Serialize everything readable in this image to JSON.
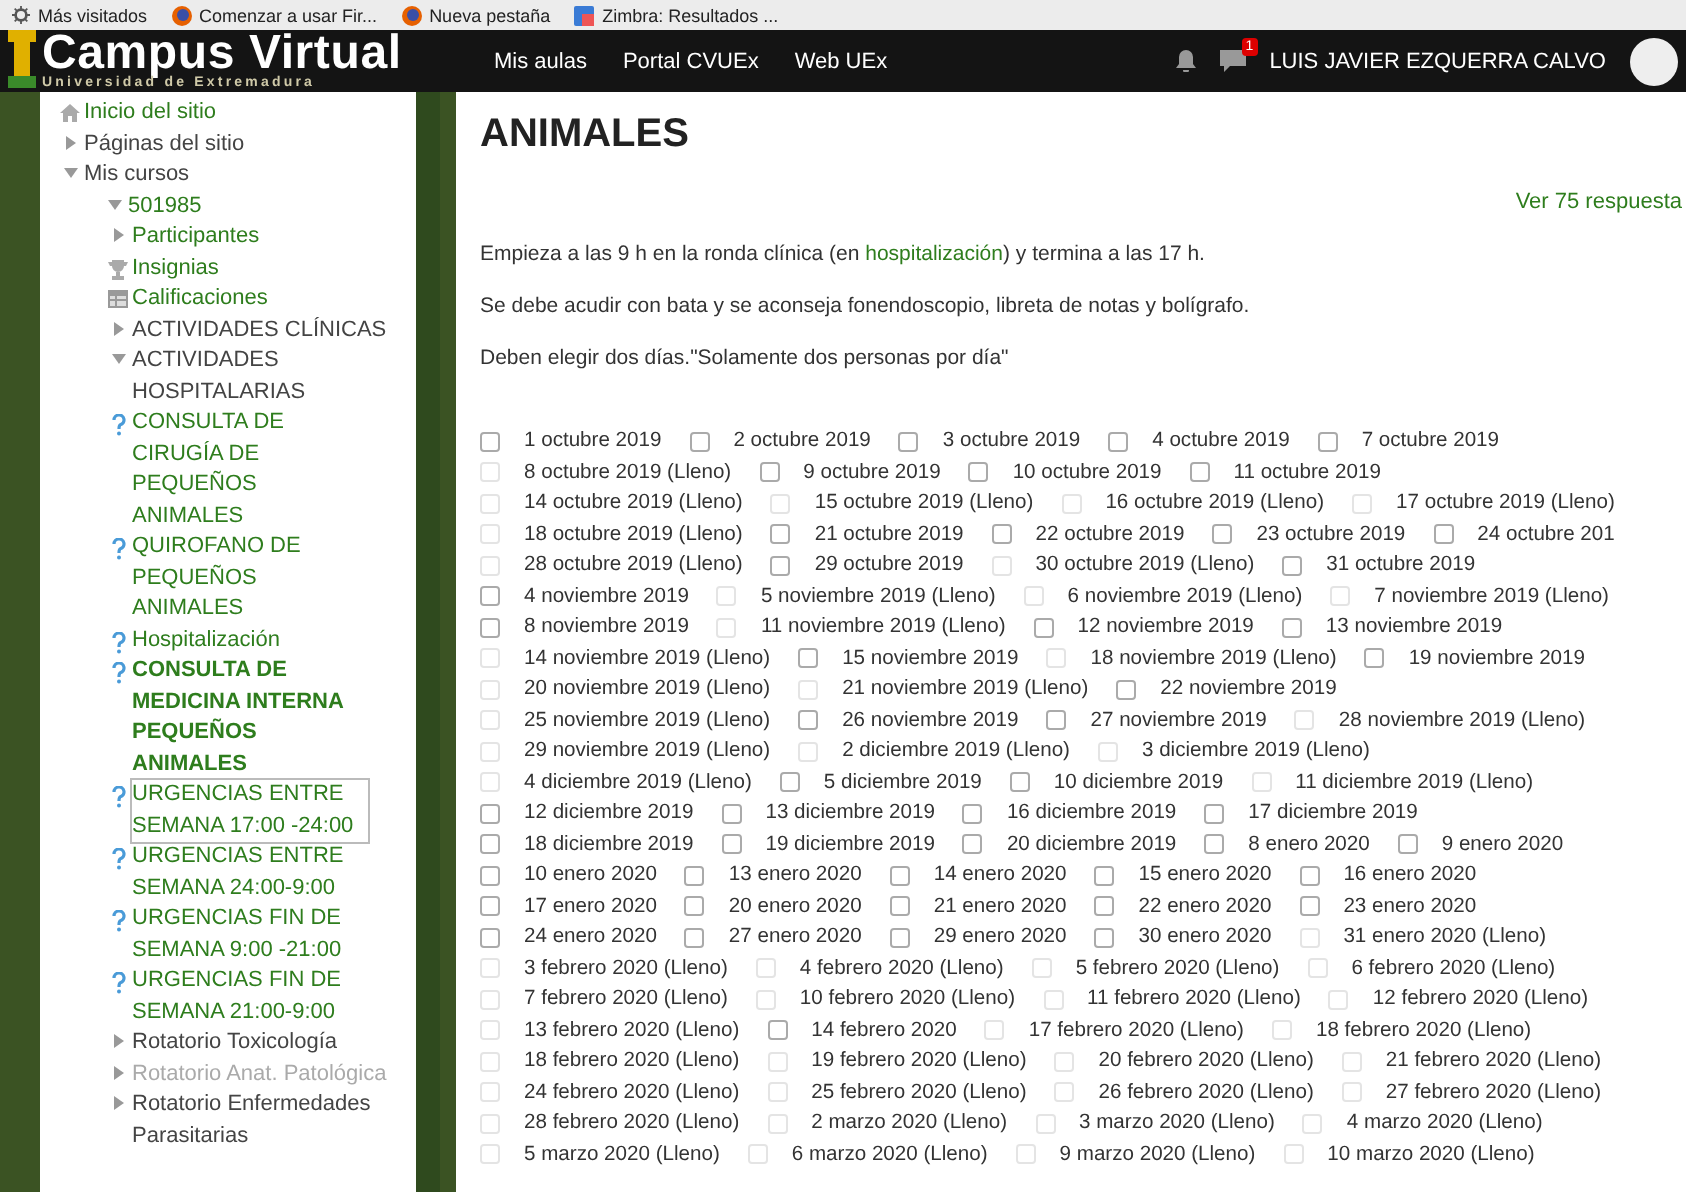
{
  "bookmarks": [
    {
      "kind": "gear",
      "label": "Más visitados"
    },
    {
      "kind": "browser",
      "label": "Comenzar a usar Fir..."
    },
    {
      "kind": "browser",
      "label": "Nueva pestaña"
    },
    {
      "kind": "mail",
      "label": "Zimbra: Resultados ..."
    }
  ],
  "header": {
    "logo_title": "Campus Virtual",
    "logo_subtitle": "Universidad de Extremadura",
    "nav": [
      "Mis aulas",
      "Portal CVUEx",
      "Web UEx"
    ],
    "message_count": "1",
    "user_name": "LUIS JAVIER EZQUERRA CALVO"
  },
  "sidebar": {
    "items": [
      {
        "kind": "home",
        "label": "Inicio del sitio"
      },
      {
        "kind": "branch",
        "label": "Páginas del sitio",
        "expanded": false
      },
      {
        "kind": "branch",
        "label": "Mis cursos",
        "expanded": true,
        "children": [
          {
            "kind": "branch",
            "label": "501985",
            "expanded": true,
            "link": true,
            "children": [
              {
                "kind": "branch",
                "label": "Participantes",
                "expanded": false,
                "link": true
              },
              {
                "kind": "badges",
                "label": "Insignias"
              },
              {
                "kind": "grades",
                "label": "Calificaciones"
              },
              {
                "kind": "branch",
                "label": "ACTIVIDADES CLÍNICAS",
                "expanded": false
              },
              {
                "kind": "branch",
                "label": "ACTIVIDADES HOSPITALARIAS",
                "expanded": true,
                "children": [
                  {
                    "kind": "quiz",
                    "label": "CONSULTA DE CIRUGÍA DE PEQUEÑOS ANIMALES",
                    "current": false,
                    "focused": false
                  },
                  {
                    "kind": "quiz",
                    "label": "QUIROFANO DE PEQUEÑOS ANIMALES",
                    "current": false,
                    "focused": false
                  },
                  {
                    "kind": "quiz",
                    "label": "Hospitalización",
                    "current": false,
                    "focused": false
                  },
                  {
                    "kind": "quiz",
                    "label": "CONSULTA DE MEDICINA INTERNA PEQUEÑOS ANIMALES",
                    "current": true,
                    "focused": false
                  },
                  {
                    "kind": "quiz",
                    "label": "URGENCIAS ENTRE SEMANA 17:00 -24:00",
                    "current": false,
                    "focused": true
                  },
                  {
                    "kind": "quiz",
                    "label": "URGENCIAS ENTRE SEMANA 24:00-9:00",
                    "current": false,
                    "focused": false
                  },
                  {
                    "kind": "quiz",
                    "label": "URGENCIAS FIN DE SEMANA 9:00 -21:00",
                    "current": false,
                    "focused": false
                  },
                  {
                    "kind": "quiz",
                    "label": "URGENCIAS FIN DE SEMANA 21:00-9:00",
                    "current": false,
                    "focused": false
                  }
                ]
              },
              {
                "kind": "branch",
                "label": "Rotatorio Toxicología",
                "expanded": false,
                "disabled": false
              },
              {
                "kind": "branch",
                "label": "Rotatorio Anat. Patológica",
                "expanded": false,
                "disabled": true
              },
              {
                "kind": "branch",
                "label": "Rotatorio Enfermedades Parasitarias",
                "expanded": false,
                "disabled": false
              }
            ]
          }
        ]
      }
    ]
  },
  "main": {
    "title": "ANIMALES",
    "responses_link": "Ver 75 respuesta",
    "intro": {
      "before": "Empieza a las 9 h en la ronda clínica (en ",
      "link": "hospitalización",
      "after": ") y termina a las 17 h."
    },
    "paragraphs": [
      "Se debe acudir con bata y se aconseja fonendoscopio, libreta de notas y bolígrafo.",
      "Deben elegir dos días.\"Solamente dos personas por día\""
    ],
    "option_rows": [
      [
        {
          "label": "1 octubre 2019",
          "disabled": false
        },
        {
          "label": "2 octubre 2019",
          "disabled": false
        },
        {
          "label": "3 octubre 2019",
          "disabled": false
        },
        {
          "label": "4 octubre 2019",
          "disabled": false
        },
        {
          "label": "7 octubre 2019",
          "disabled": false
        }
      ],
      [
        {
          "label": "8 octubre 2019 (Lleno)",
          "disabled": true
        },
        {
          "label": "9 octubre 2019",
          "disabled": false
        },
        {
          "label": "10 octubre 2019",
          "disabled": false
        },
        {
          "label": "11 octubre 2019",
          "disabled": false
        }
      ],
      [
        {
          "label": "14 octubre 2019 (Lleno)",
          "disabled": true
        },
        {
          "label": "15 octubre 2019 (Lleno)",
          "disabled": true
        },
        {
          "label": "16 octubre 2019 (Lleno)",
          "disabled": true
        },
        {
          "label": "17 octubre 2019 (Lleno)",
          "disabled": true
        }
      ],
      [
        {
          "label": "18 octubre 2019 (Lleno)",
          "disabled": true
        },
        {
          "label": "21 octubre 2019",
          "disabled": false
        },
        {
          "label": "22 octubre 2019",
          "disabled": false
        },
        {
          "label": "23 octubre 2019",
          "disabled": false
        },
        {
          "label": "24 octubre 201",
          "disabled": false
        }
      ],
      [
        {
          "label": "28 octubre 2019 (Lleno)",
          "disabled": true
        },
        {
          "label": "29 octubre 2019",
          "disabled": false
        },
        {
          "label": "30 octubre 2019 (Lleno)",
          "disabled": true
        },
        {
          "label": "31 octubre 2019",
          "disabled": false
        }
      ],
      [
        {
          "label": "4 noviembre 2019",
          "disabled": false
        },
        {
          "label": "5 noviembre 2019 (Lleno)",
          "disabled": true
        },
        {
          "label": "6 noviembre 2019 (Lleno)",
          "disabled": true
        },
        {
          "label": "7 noviembre 2019 (Lleno)",
          "disabled": true
        }
      ],
      [
        {
          "label": "8 noviembre 2019",
          "disabled": false
        },
        {
          "label": "11 noviembre 2019 (Lleno)",
          "disabled": true
        },
        {
          "label": "12 noviembre 2019",
          "disabled": false
        },
        {
          "label": "13 noviembre 2019",
          "disabled": false
        }
      ],
      [
        {
          "label": "14 noviembre 2019 (Lleno)",
          "disabled": true
        },
        {
          "label": "15 noviembre 2019",
          "disabled": false
        },
        {
          "label": "18 noviembre 2019 (Lleno)",
          "disabled": true
        },
        {
          "label": "19 noviembre 2019",
          "disabled": false
        }
      ],
      [
        {
          "label": "20 noviembre 2019 (Lleno)",
          "disabled": true
        },
        {
          "label": "21 noviembre 2019 (Lleno)",
          "disabled": true
        },
        {
          "label": "22 noviembre 2019",
          "disabled": false
        }
      ],
      [
        {
          "label": "25 noviembre 2019 (Lleno)",
          "disabled": true
        },
        {
          "label": "26 noviembre 2019",
          "disabled": false
        },
        {
          "label": "27 noviembre 2019",
          "disabled": false
        },
        {
          "label": "28 noviembre 2019 (Lleno)",
          "disabled": true
        }
      ],
      [
        {
          "label": "29 noviembre 2019 (Lleno)",
          "disabled": true
        },
        {
          "label": "2 diciembre 2019 (Lleno)",
          "disabled": true
        },
        {
          "label": "3 diciembre 2019 (Lleno)",
          "disabled": true
        }
      ],
      [
        {
          "label": "4 diciembre 2019 (Lleno)",
          "disabled": true
        },
        {
          "label": "5 diciembre 2019",
          "disabled": false
        },
        {
          "label": "10 diciembre 2019",
          "disabled": false
        },
        {
          "label": "11 diciembre 2019 (Lleno)",
          "disabled": true
        }
      ],
      [
        {
          "label": "12 diciembre 2019",
          "disabled": false
        },
        {
          "label": "13 diciembre 2019",
          "disabled": false
        },
        {
          "label": "16 diciembre 2019",
          "disabled": false
        },
        {
          "label": "17 diciembre 2019",
          "disabled": false
        }
      ],
      [
        {
          "label": "18 diciembre 2019",
          "disabled": false
        },
        {
          "label": "19 diciembre 2019",
          "disabled": false
        },
        {
          "label": "20 diciembre 2019",
          "disabled": false
        },
        {
          "label": "8 enero 2020",
          "disabled": false
        },
        {
          "label": "9 enero 2020",
          "disabled": false
        }
      ],
      [
        {
          "label": "10 enero 2020",
          "disabled": false
        },
        {
          "label": "13 enero 2020",
          "disabled": false
        },
        {
          "label": "14 enero 2020",
          "disabled": false
        },
        {
          "label": "15 enero 2020",
          "disabled": false
        },
        {
          "label": "16 enero 2020",
          "disabled": false
        }
      ],
      [
        {
          "label": "17 enero 2020",
          "disabled": false
        },
        {
          "label": "20 enero 2020",
          "disabled": false
        },
        {
          "label": "21 enero 2020",
          "disabled": false
        },
        {
          "label": "22 enero 2020",
          "disabled": false
        },
        {
          "label": "23 enero 2020",
          "disabled": false
        }
      ],
      [
        {
          "label": "24 enero 2020",
          "disabled": false
        },
        {
          "label": "27 enero 2020",
          "disabled": false
        },
        {
          "label": "29 enero 2020",
          "disabled": false
        },
        {
          "label": "30 enero 2020",
          "disabled": false
        },
        {
          "label": "31 enero 2020 (Lleno)",
          "disabled": true
        }
      ],
      [
        {
          "label": "3 febrero 2020 (Lleno)",
          "disabled": true
        },
        {
          "label": "4 febrero 2020 (Lleno)",
          "disabled": true
        },
        {
          "label": "5 febrero 2020 (Lleno)",
          "disabled": true
        },
        {
          "label": "6 febrero 2020 (Lleno)",
          "disabled": true
        }
      ],
      [
        {
          "label": "7 febrero 2020 (Lleno)",
          "disabled": true
        },
        {
          "label": "10 febrero 2020 (Lleno)",
          "disabled": true
        },
        {
          "label": "11 febrero 2020 (Lleno)",
          "disabled": true
        },
        {
          "label": "12 febrero 2020 (Lleno)",
          "disabled": true
        }
      ],
      [
        {
          "label": "13 febrero 2020 (Lleno)",
          "disabled": true
        },
        {
          "label": "14 febrero 2020",
          "disabled": false
        },
        {
          "label": "17 febrero 2020 (Lleno)",
          "disabled": true
        },
        {
          "label": "18 febrero 2020 (Lleno)",
          "disabled": true
        }
      ],
      [
        {
          "label": "18 febrero 2020 (Lleno)",
          "disabled": true
        },
        {
          "label": "19 febrero 2020 (Lleno)",
          "disabled": true
        },
        {
          "label": "20 febrero 2020 (Lleno)",
          "disabled": true
        },
        {
          "label": "21 febrero 2020 (Lleno)",
          "disabled": true
        }
      ],
      [
        {
          "label": "24 febrero 2020 (Lleno)",
          "disabled": true
        },
        {
          "label": "25 febrero 2020 (Lleno)",
          "disabled": true
        },
        {
          "label": "26 febrero 2020 (Lleno)",
          "disabled": true
        },
        {
          "label": "27 febrero 2020 (Lleno)",
          "disabled": true
        }
      ],
      [
        {
          "label": "28 febrero 2020 (Lleno)",
          "disabled": true
        },
        {
          "label": "2 marzo 2020 (Lleno)",
          "disabled": true
        },
        {
          "label": "3 marzo 2020 (Lleno)",
          "disabled": true
        },
        {
          "label": "4 marzo 2020 (Lleno)",
          "disabled": true
        }
      ],
      [
        {
          "label": "5 marzo 2020 (Lleno)",
          "disabled": true
        },
        {
          "label": "6 marzo 2020 (Lleno)",
          "disabled": true
        },
        {
          "label": "9 marzo 2020 (Lleno)",
          "disabled": true
        },
        {
          "label": "10 marzo 2020 (Lleno)",
          "disabled": true
        }
      ]
    ]
  }
}
